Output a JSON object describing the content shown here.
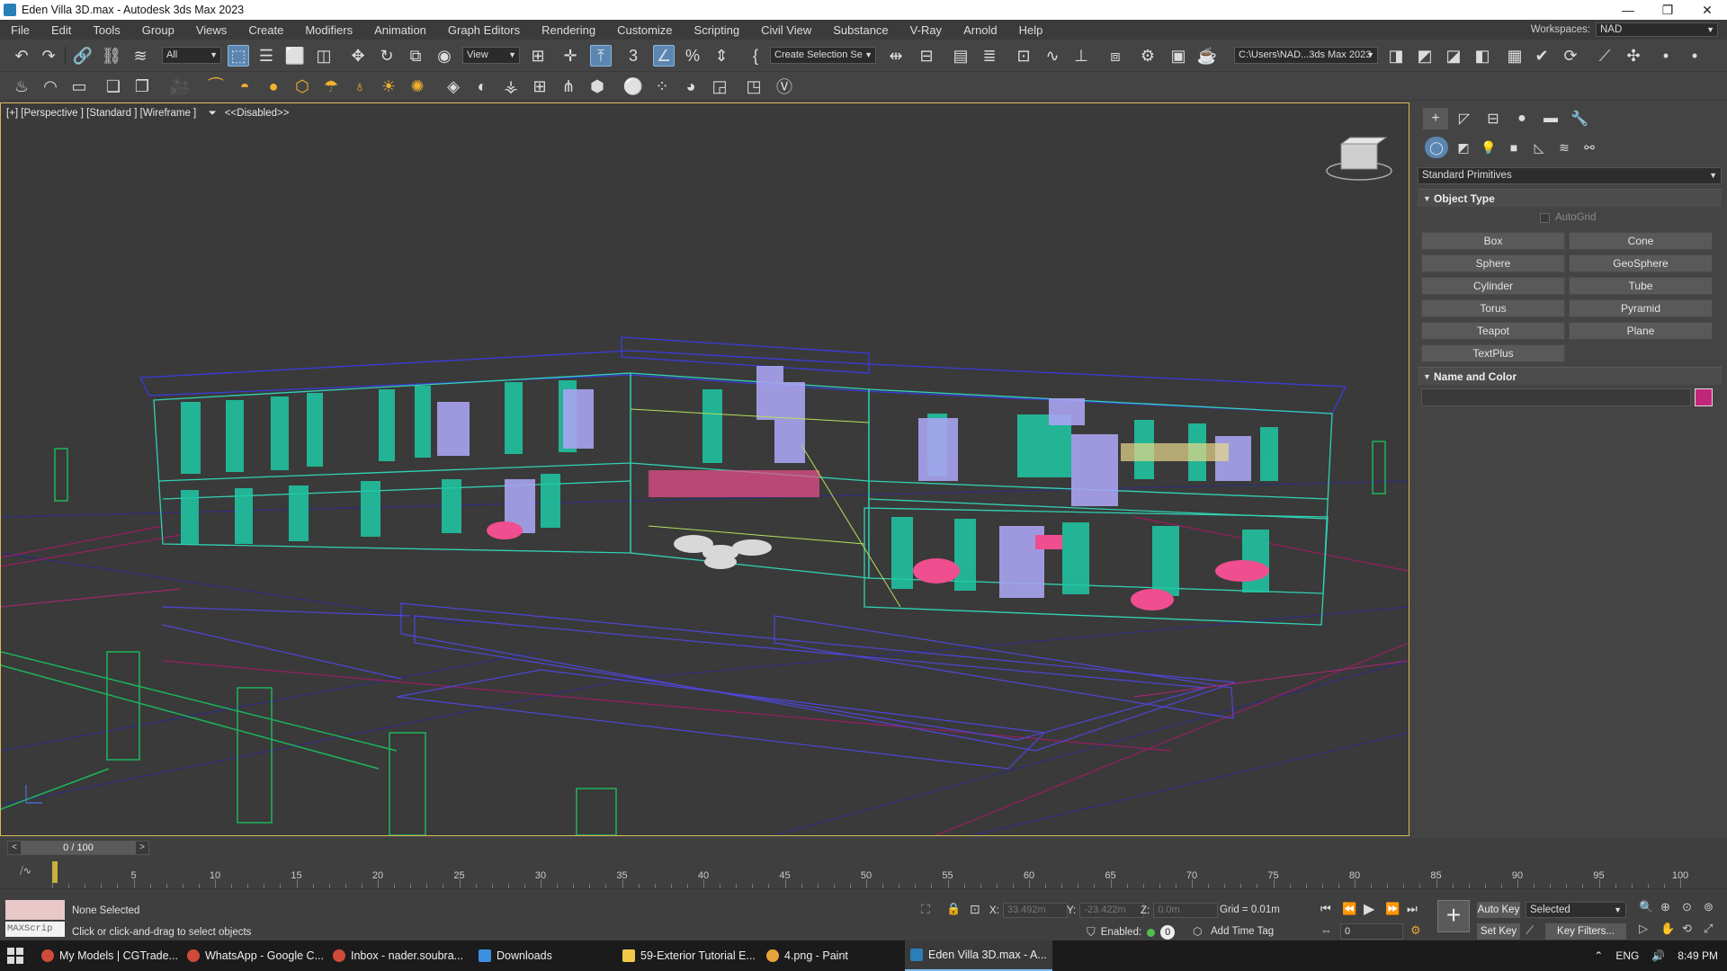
{
  "window": {
    "title": "Eden Villa 3D.max - Autodesk 3ds Max 2023",
    "controls": [
      "—",
      "❐",
      "✕"
    ]
  },
  "menu": {
    "items": [
      "File",
      "Edit",
      "Tools",
      "Group",
      "Views",
      "Create",
      "Modifiers",
      "Animation",
      "Graph Editors",
      "Rendering",
      "Customize",
      "Scripting",
      "Civil View",
      "Substance",
      "V-Ray",
      "Arnold",
      "Help"
    ],
    "workspaces_label": "Workspaces:",
    "workspace_value": "NAD"
  },
  "toolbar": {
    "selection_filter": "All",
    "ref_coord": "View",
    "named_selection_placeholder": "Create Selection Se",
    "project_path": "C:\\Users\\NAD...3ds Max 2023"
  },
  "viewport": {
    "label": "[+] [Perspective ] [Standard ] [Wireframe ]",
    "filter_label": "<<Disabled>>"
  },
  "command_panel": {
    "category": "Standard Primitives",
    "object_type_title": "Object Type",
    "autogrid_label": "AutoGrid",
    "buttons": [
      "Box",
      "Cone",
      "Sphere",
      "GeoSphere",
      "Cylinder",
      "Tube",
      "Torus",
      "Pyramid",
      "Teapot",
      "Plane",
      "TextPlus"
    ],
    "name_color_title": "Name and Color",
    "object_color": "#c2267a"
  },
  "timeline": {
    "slider_label": "0 / 100",
    "ticks": [
      "5",
      "10",
      "15",
      "20",
      "25",
      "30",
      "35",
      "40",
      "45",
      "50",
      "55",
      "60",
      "65",
      "70",
      "75",
      "80",
      "85",
      "90",
      "95",
      "100"
    ]
  },
  "status": {
    "maxscript_label": "MAXScrip",
    "selection": "None Selected",
    "prompt": "Click or click-and-drag to select objects",
    "x_label": "X:",
    "x_value": "33.492m",
    "y_label": "Y:",
    "y_value": "-23.422m",
    "z_label": "Z:",
    "z_value": "0.0m",
    "grid": "Grid = 0.01m",
    "enabled_label": "Enabled:",
    "enabled_value": "0",
    "add_time_tag": "Add Time Tag",
    "frame_value": "0",
    "auto_key": "Auto Key",
    "set_key": "Set Key",
    "key_mode": "Selected",
    "key_filters": "Key Filters..."
  },
  "taskbar": {
    "tasks": [
      {
        "label": "My Models | CGTrade...",
        "color": "#d04a3a"
      },
      {
        "label": "WhatsApp - Google C...",
        "color": "#d04a3a"
      },
      {
        "label": "Inbox - nader.soubra...",
        "color": "#d04a3a"
      },
      {
        "label": "Downloads",
        "color": "#3d8fe0"
      },
      {
        "label": "59-Exterior Tutorial E...",
        "color": "#f0c94a"
      },
      {
        "label": "4.png - Paint",
        "color": "#e8a33a"
      },
      {
        "label": "Eden Villa 3D.max - A...",
        "color": "#2a7fb8"
      }
    ],
    "lang": "ENG",
    "time": "8:49 PM"
  }
}
